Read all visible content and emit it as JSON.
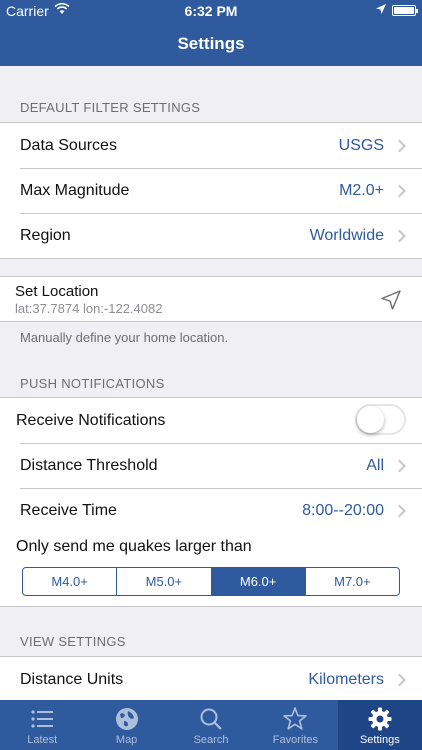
{
  "status": {
    "carrier": "Carrier",
    "time": "6:32 PM"
  },
  "nav": {
    "title": "Settings"
  },
  "filter": {
    "header": "DEFAULT FILTER SETTINGS",
    "rows": [
      {
        "label": "Data Sources",
        "value": "USGS"
      },
      {
        "label": "Max Magnitude",
        "value": "M2.0+"
      },
      {
        "label": "Region",
        "value": "Worldwide"
      }
    ]
  },
  "location": {
    "title": "Set Location",
    "coords": "lat:37.7874 lon:-122.4082",
    "note": "Manually define your home location."
  },
  "push": {
    "header": "PUSH NOTIFICATIONS",
    "receive_label": "Receive Notifications",
    "receive_on": false,
    "rows": [
      {
        "label": "Distance Threshold",
        "value": "All"
      },
      {
        "label": "Receive Time",
        "value": "8:00--20:00"
      }
    ],
    "quake_label": "Only send me quakes larger than",
    "segments": [
      "M4.0+",
      "M5.0+",
      "M6.0+",
      "M7.0+"
    ],
    "selected_segment": "M6.0+"
  },
  "view": {
    "header": "VIEW SETTINGS",
    "rows": [
      {
        "label": "Distance Units",
        "value": "Kilometers"
      }
    ]
  },
  "tabs": [
    {
      "label": "Latest",
      "icon": "list-icon"
    },
    {
      "label": "Map",
      "icon": "globe-icon"
    },
    {
      "label": "Search",
      "icon": "search-icon"
    },
    {
      "label": "Favorites",
      "icon": "star-icon"
    },
    {
      "label": "Settings",
      "icon": "gear-icon",
      "active": true
    }
  ],
  "colors": {
    "accent": "#2f5a9e",
    "background": "#efeff4"
  }
}
